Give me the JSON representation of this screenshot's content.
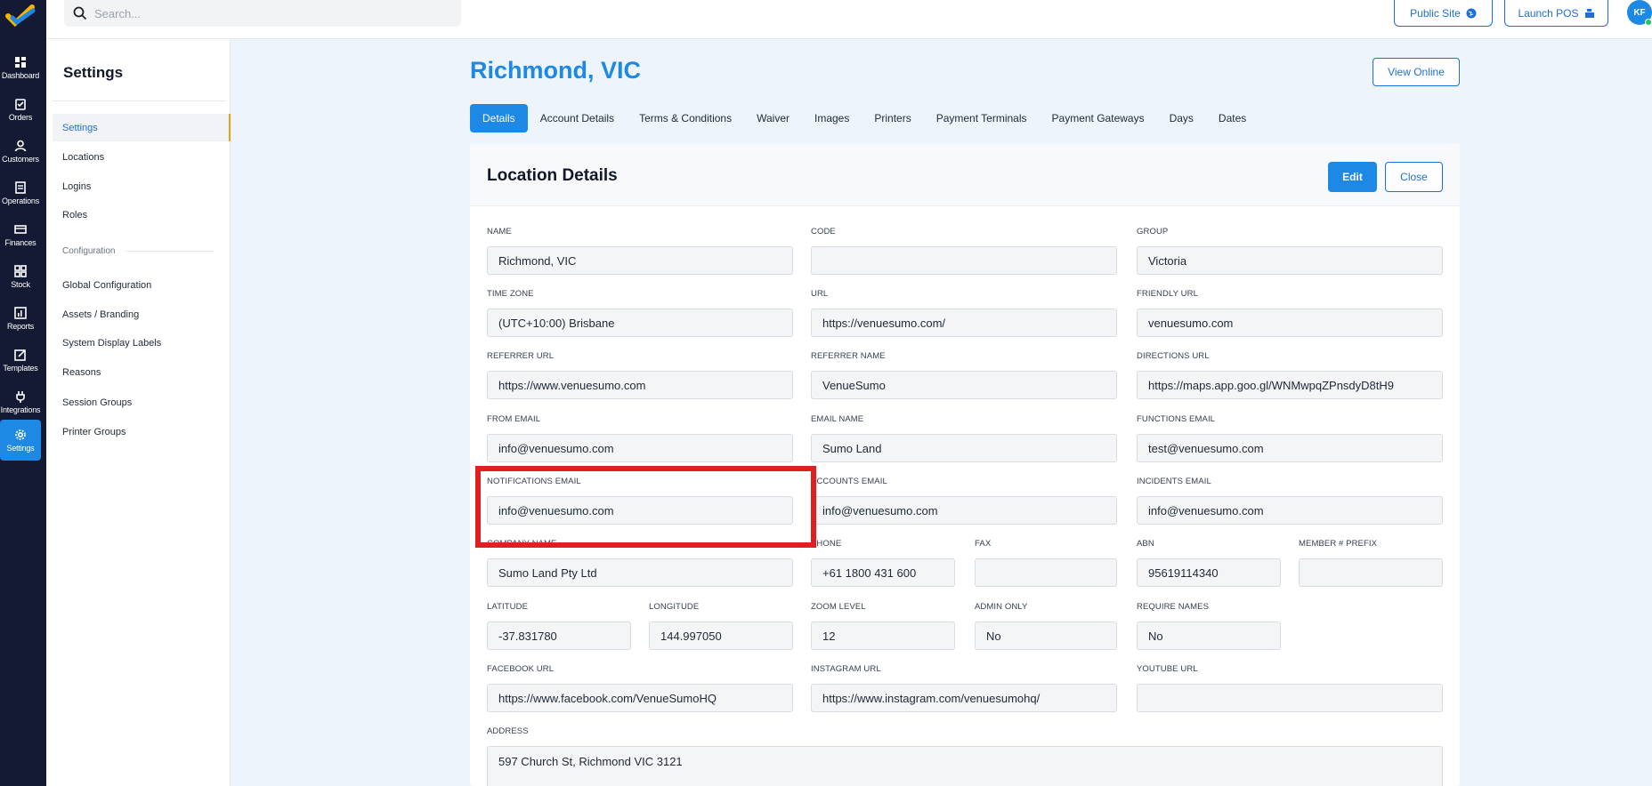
{
  "rail": {
    "items": [
      {
        "label": "Dashboard",
        "icon": "dashboard-icon"
      },
      {
        "label": "Orders",
        "icon": "orders-icon"
      },
      {
        "label": "Customers",
        "icon": "customers-icon"
      },
      {
        "label": "Operations",
        "icon": "operations-icon"
      },
      {
        "label": "Finances",
        "icon": "finances-icon"
      },
      {
        "label": "Stock",
        "icon": "stock-icon"
      },
      {
        "label": "Reports",
        "icon": "reports-icon"
      },
      {
        "label": "Templates",
        "icon": "templates-icon"
      },
      {
        "label": "Integrations",
        "icon": "integrations-icon"
      },
      {
        "label": "Settings",
        "icon": "settings-icon"
      }
    ],
    "active": "Settings"
  },
  "topbar": {
    "search_placeholder": "Search...",
    "public_site_label": "Public Site",
    "launch_pos_label": "Launch POS",
    "avatar_initials": "KF"
  },
  "sidebar": {
    "title": "Settings",
    "items": [
      "Settings",
      "Locations",
      "Logins",
      "Roles"
    ],
    "section_label": "Configuration",
    "config_items": [
      "Global Configuration",
      "Assets / Branding",
      "System Display Labels",
      "Reasons",
      "Session Groups",
      "Printer Groups"
    ]
  },
  "page": {
    "title": "Richmond, VIC",
    "view_online_label": "View Online",
    "tabs": [
      "Details",
      "Account Details",
      "Terms & Conditions",
      "Waiver",
      "Images",
      "Printers",
      "Payment Terminals",
      "Payment Gateways",
      "Days",
      "Dates"
    ],
    "active_tab": "Details"
  },
  "card": {
    "title": "Location Details",
    "edit_label": "Edit",
    "close_label": "Close"
  },
  "fields": {
    "name": {
      "label": "NAME",
      "value": "Richmond, VIC"
    },
    "code": {
      "label": "CODE",
      "value": ""
    },
    "group": {
      "label": "GROUP",
      "value": "Victoria"
    },
    "time_zone": {
      "label": "TIME ZONE",
      "value": "(UTC+10:00) Brisbane"
    },
    "url": {
      "label": "URL",
      "value": "https://venuesumo.com/"
    },
    "friendly_url": {
      "label": "FRIENDLY URL",
      "value": "venuesumo.com"
    },
    "referrer_url": {
      "label": "REFERRER URL",
      "value": "https://www.venuesumo.com"
    },
    "referrer_name": {
      "label": "REFERRER NAME",
      "value": "VenueSumo"
    },
    "directions_url": {
      "label": "DIRECTIONS URL",
      "value": "https://maps.app.goo.gl/WNMwpqZPnsdyD8tH9"
    },
    "from_email": {
      "label": "FROM EMAIL",
      "value": "info@venuesumo.com"
    },
    "email_name": {
      "label": "EMAIL NAME",
      "value": "Sumo Land"
    },
    "functions_email": {
      "label": "FUNCTIONS EMAIL",
      "value": "test@venuesumo.com"
    },
    "notifications_email": {
      "label": "NOTIFICATIONS EMAIL",
      "value": "info@venuesumo.com"
    },
    "accounts_email": {
      "label": "ACCOUNTS EMAIL",
      "value": "info@venuesumo.com"
    },
    "incidents_email": {
      "label": "INCIDENTS EMAIL",
      "value": "info@venuesumo.com"
    },
    "company_name": {
      "label": "COMPANY NAME",
      "value": "Sumo Land Pty Ltd"
    },
    "phone": {
      "label": "PHONE",
      "value": "+61 1800 431 600"
    },
    "fax": {
      "label": "FAX",
      "value": ""
    },
    "abn": {
      "label": "ABN",
      "value": "95619114340"
    },
    "member_prefix": {
      "label": "MEMBER # PREFIX",
      "value": ""
    },
    "latitude": {
      "label": "LATITUDE",
      "value": "-37.831780"
    },
    "longitude": {
      "label": "LONGITUDE",
      "value": "144.997050"
    },
    "zoom_level": {
      "label": "ZOOM LEVEL",
      "value": "12"
    },
    "admin_only": {
      "label": "ADMIN ONLY",
      "value": "No"
    },
    "require_names": {
      "label": "REQUIRE NAMES",
      "value": "No"
    },
    "facebook_url": {
      "label": "FACEBOOK URL",
      "value": "https://www.facebook.com/VenueSumoHQ"
    },
    "instagram_url": {
      "label": "INSTAGRAM URL",
      "value": "https://www.instagram.com/venuesumohq/"
    },
    "youtube_url": {
      "label": "YOUTUBE URL",
      "value": ""
    },
    "address": {
      "label": "ADDRESS",
      "value": "597 Church St, Richmond VIC 3121"
    }
  },
  "colors": {
    "accent": "#1e88e5",
    "rail_bg": "#141a33",
    "highlight": "#e02020"
  }
}
